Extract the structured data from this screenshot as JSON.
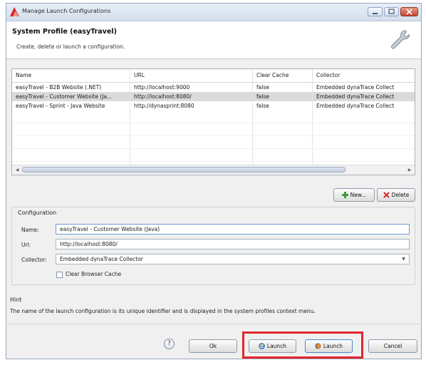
{
  "window": {
    "title": "Manage Launch Configurations",
    "buttons": [
      "minimize",
      "maximize",
      "close"
    ]
  },
  "header": {
    "title": "System Profile (easyTravel)",
    "subtitle": "Create, delete or launch a configuration.",
    "icon": "wrench-icon"
  },
  "table": {
    "columns": [
      "Name",
      "URL",
      "Clear Cache",
      "Collector"
    ],
    "rows": [
      [
        "easyTravel - B2B Website (.NET)",
        "http://localhost:9000",
        "false",
        "Embedded dynaTrace Collect"
      ],
      [
        "easyTravel - Customer Website (Ja...",
        "http://localhost:8080/",
        "false",
        "Embedded dynaTrace Collect"
      ],
      [
        "easyTravel - Sprint - Java Website",
        "http://dynasprint:8080",
        "false",
        "Embedded dynaTrace Collect"
      ]
    ],
    "selected_row": 1
  },
  "actions": {
    "new_label": "New...",
    "delete_label": "Delete"
  },
  "configuration": {
    "section_title": "Configuration",
    "name_label": "Name:",
    "name_value": "easyTravel - Customer Website (Java)",
    "url_label": "Url:",
    "url_value": "http://localhost:8080/",
    "collector_label": "Collector:",
    "collector_value": "Embedded dynaTrace Collector",
    "clear_cache_label": "Clear Browser Cache",
    "clear_cache_checked": false
  },
  "hint": {
    "title": "Hint",
    "text": "The name of the launch configuration is its unique identifier and is displayed in the system profiles context menu."
  },
  "footer": {
    "help_symbol": "?",
    "ok_label": "Ok",
    "launch_ie_label": "Launch",
    "launch_firefox_label": "Launch",
    "cancel_label": "Cancel"
  },
  "colors": {
    "highlight": "#e1262c",
    "selected_row": "#dadada"
  }
}
